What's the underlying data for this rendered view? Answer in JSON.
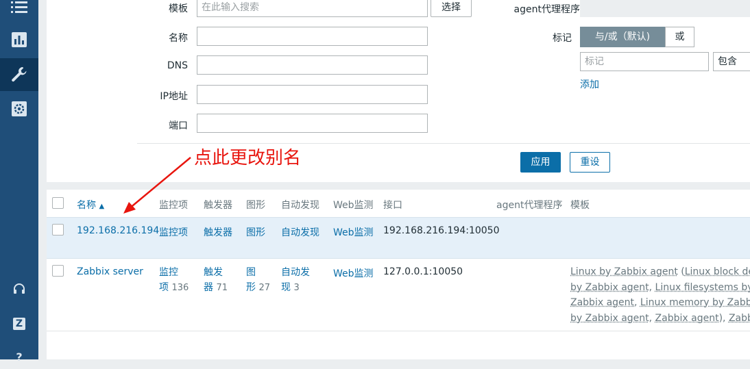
{
  "sidebar": {
    "icons": [
      "list-icon",
      "chart-icon",
      "wrench-icon",
      "gear-icon",
      "headset-icon",
      "zabbix-z-icon",
      "help-icon"
    ],
    "help_label": "?",
    "z_label": "Z"
  },
  "filter": {
    "template_label": "模板",
    "template_placeholder": "在此输入搜索",
    "select_label": "选择",
    "proxy_label": "agent代理程序",
    "name_label": "名称",
    "dns_label": "DNS",
    "ip_label": "IP地址",
    "port_label": "端口",
    "tags_label": "标记",
    "tags_andor": "与/或（默认)",
    "tags_or": "或",
    "tag_placeholder": "标记",
    "tag_operator": "包含",
    "add_label": "添加",
    "apply_label": "应用",
    "reset_label": "重设"
  },
  "annotation": {
    "text": "点此更改别名",
    "color": "#e8150e"
  },
  "table": {
    "headers": {
      "name": "名称",
      "sort_indicator": "▲",
      "items": "监控项",
      "triggers": "触发器",
      "graphs": "图形",
      "discovery": "自动发现",
      "web": "Web监测",
      "interface": "接口",
      "proxy": "agent代理程序",
      "templates": "模板"
    },
    "rows": [
      {
        "name": "192.168.216.194",
        "items": "监控项",
        "triggers": "触发器",
        "graphs": "图形",
        "discovery": "自动发现",
        "web": "Web监测",
        "interface": "192.168.216.194:10050"
      },
      {
        "name": "Zabbix server",
        "items_a": "监控",
        "items_b": "项",
        "items_count": "136",
        "triggers_a": "触发",
        "triggers_b": "器",
        "triggers_count": "71",
        "graphs_a": "图",
        "graphs_b": "形",
        "graphs_count": "27",
        "discovery_a": "自动发",
        "discovery_b": "现",
        "discovery_count": "3",
        "web": "Web监测",
        "interface": "127.0.0.1:10050",
        "templates": {
          "t1": "Linux by Zabbix agent",
          "t2": "Linux block device",
          "t3": "by Zabbix agent",
          "t4": "Linux filesystems by Zal",
          "t5": "Zabbix agent",
          "t6": "Linux memory by Zabbix ag",
          "t7": "by Zabbix agent",
          "t8": "Zabbix agent",
          "t9": "Zabbix se"
        }
      }
    ]
  },
  "colors": {
    "sidebar": "#1f4e79",
    "link": "#0b6ea8",
    "selected_row": "#e5f0f9"
  }
}
